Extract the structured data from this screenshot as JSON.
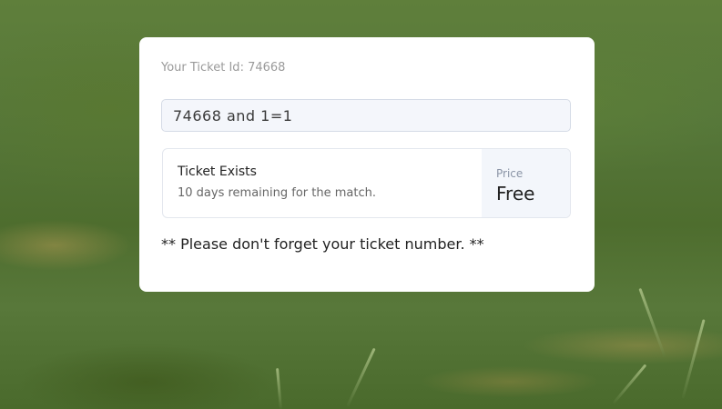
{
  "ticket": {
    "id_label": "Your Ticket Id: 74668",
    "input_value": "74668 and 1=1"
  },
  "result": {
    "title": "Ticket Exists",
    "subtitle": "10 days remaining for the match.",
    "price_label": "Price",
    "price_value": "Free"
  },
  "note": "** Please don't forget your ticket number. **",
  "colors": {
    "card_background": "#ffffff",
    "input_background": "#f4f6fb",
    "price_panel_background": "#f3f6fb",
    "grass_green": "#56773a"
  }
}
